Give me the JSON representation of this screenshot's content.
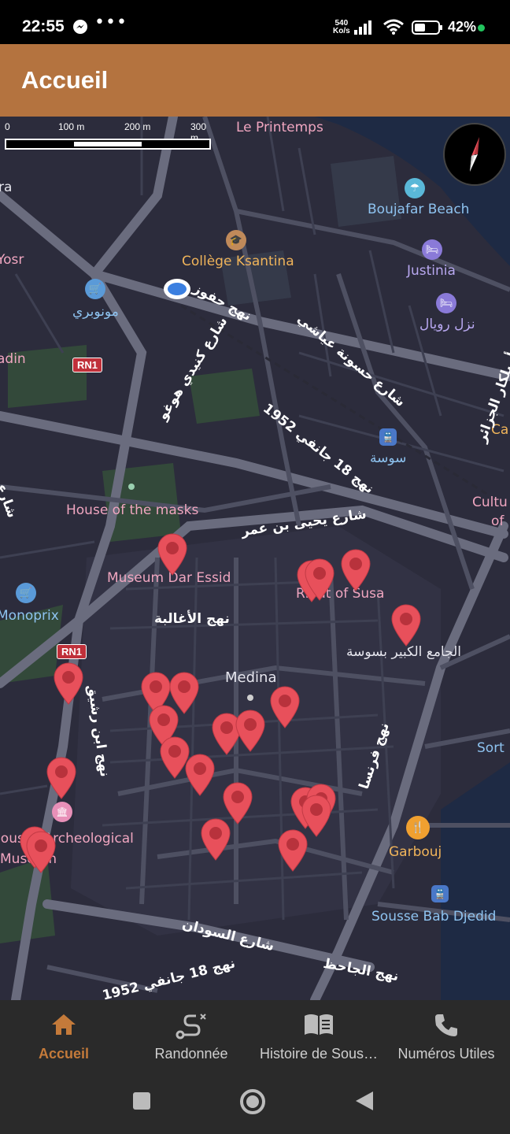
{
  "status_bar": {
    "time": "22:55",
    "speed_value": "540",
    "speed_unit": "Ko/s",
    "battery_pct": "42%",
    "icons": [
      "messenger-icon",
      "more-dots-icon",
      "signal-icon",
      "wifi-icon",
      "battery-icon"
    ]
  },
  "app_bar": {
    "title": "Accueil"
  },
  "map": {
    "scale": {
      "t0": "0",
      "t100": "100 m",
      "t200": "200 m",
      "t300": "300 m"
    },
    "labels": {
      "le_printemps": "Le Printemps",
      "boujafar": "Boujafar Beach",
      "college": "Collège Ksantina",
      "justinia": "Justinia",
      "monoprix_ar": "مونوبري",
      "hotel_royal": "نزل رويال",
      "sousse_ar": "سوسة",
      "house_masks": "House of the masks",
      "museum_dar_essid": "Museum Dar Essid",
      "ribat": "Ribat of Susa",
      "grand_mosque": "الجامع الكبير بسوسة",
      "medina": "Medina",
      "monoprix": "Monoprix",
      "archeo": "Sousse Archeological Museum",
      "garbouj": "Garbouj",
      "bab_djedid": "Sousse Bab Djedid",
      "yosr": "Yosr",
      "ra": "ra",
      "adin": "adin",
      "ca": "Ca",
      "cultu": "Cultu",
      "of": "of",
      "sort": "Sort",
      "st_hafour": "نهج حفوز",
      "st_kennedy": "شارع كنيدي هوغو",
      "st_hassouna": "شارع حسونة عياشي",
      "st_18jan": "نهج 18 جانفي 1952",
      "st_yahia": "شارع يحيى بن عمر",
      "st_aghaliba": "نهج الأغالبة",
      "st_soudan": "شارع السودان",
      "st_jahedh": "نهج الجاحظ",
      "st_france": "نهج فرنسا",
      "st_18jan_b": "نهج 18 جانفي 1952",
      "st_ibn": "نهج ابن رشيق",
      "st_aljazair": "نهج أميلكار الجزائر",
      "st_bottom_left": "شارع"
    },
    "road_badges": [
      "RN1",
      "RN1"
    ],
    "pins_count": 23,
    "colors": {
      "pin": "#e8505b",
      "water": "#1e2a44",
      "park": "#33493a",
      "road": "#5e6072",
      "accent": "#b4733f"
    }
  },
  "bottom_nav": {
    "items": [
      {
        "label": "Accueil",
        "icon": "home-icon",
        "active": true
      },
      {
        "label": "Randonnée",
        "icon": "route-icon",
        "active": false
      },
      {
        "label": "Histoire de Sous…",
        "icon": "book-icon",
        "active": false
      },
      {
        "label": "Numéros Utiles",
        "icon": "phone-icon",
        "active": false
      }
    ]
  },
  "system_nav": {
    "icons": [
      "recents-square-icon",
      "home-circle-icon",
      "back-triangle-icon"
    ]
  }
}
